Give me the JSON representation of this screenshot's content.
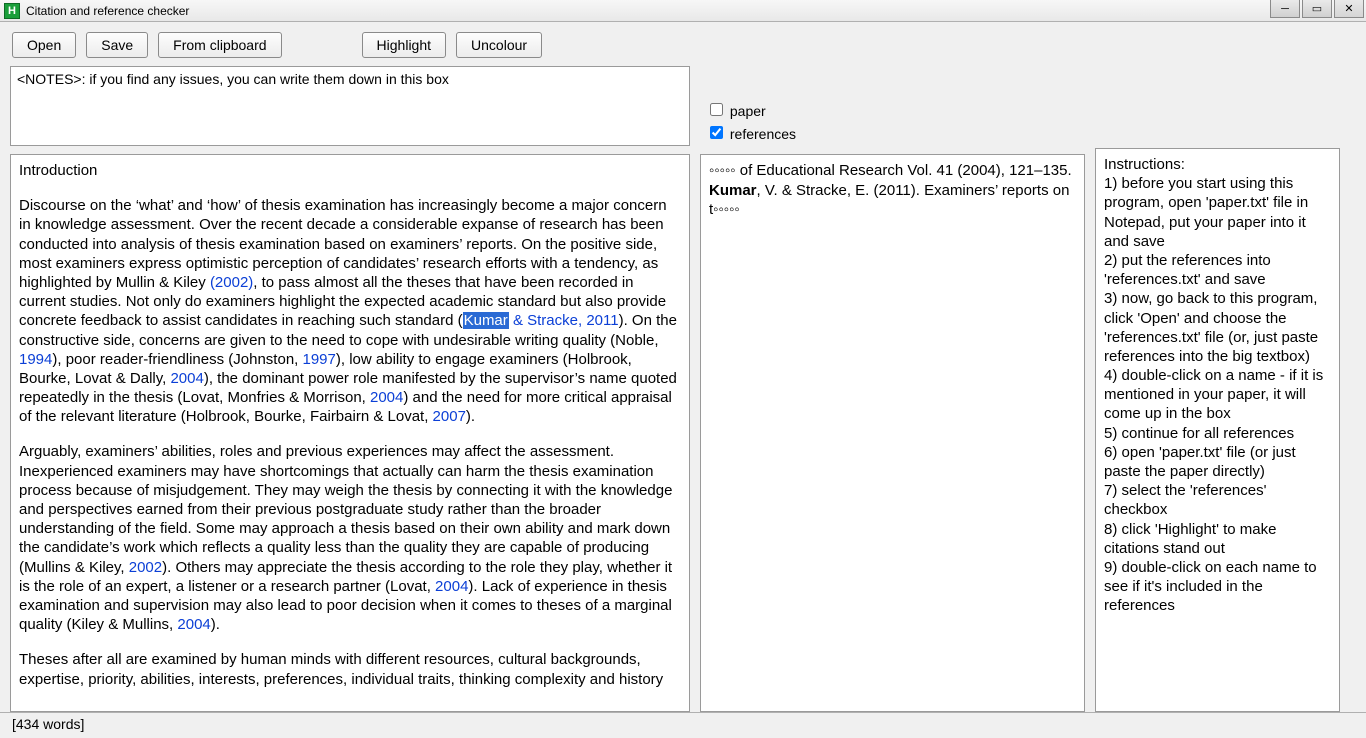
{
  "window": {
    "title": "Citation and reference checker",
    "icon_letter": "H"
  },
  "toolbar": {
    "open": "Open",
    "save": "Save",
    "from_clipboard": "From clipboard",
    "highlight": "Highlight",
    "uncolour": "Uncolour"
  },
  "notes": {
    "value": "<NOTES>: if you find any issues, you can write them down in this box"
  },
  "paper": {
    "heading": "Introduction",
    "para1_a": "Discourse on the ‘what’ and ‘how’ of thesis examination has increasingly become a major concern in knowledge assessment. Over the recent decade a considerable expanse of research has been conducted into analysis of thesis examination based on examiners’ reports. On the positive side, most examiners express optimistic perception of candidates’ research efforts with a tendency, as highlighted by Mullin & Kiley ",
    "cit1": "(2002)",
    "para1_b": ", to pass almost all the theses that have been recorded in current studies. Not only do examiners highlight the expected academic standard but also provide concrete feedback to assist candidates in reaching such standard (",
    "cit2_hl": "Kumar",
    "cit2_rest": " & Stracke, ",
    "cit2_year": "2011",
    "para1_c": "). On the constructive side, concerns are given to the need to cope with undesirable writing quality (Noble, ",
    "cit3": "1994",
    "para1_d": "), poor reader-friendliness (Johnston, ",
    "cit4": "1997",
    "para1_e": "), low ability to engage examiners (Holbrook, Bourke, Lovat & Dally, ",
    "cit5": "2004",
    "para1_f": "), the dominant power role manifested by the supervisor’s name quoted repeatedly in the thesis (Lovat, Monfries & Morrison, ",
    "cit6": "2004",
    "para1_g": ") and the need for more critical appraisal of the relevant literature (Holbrook, Bourke, Fairbairn & Lovat, ",
    "cit7": "2007",
    "para1_h": ").",
    "para2_a": "Arguably, examiners’ abilities, roles and previous experiences may affect the assessment. Inexperienced examiners may have shortcomings that actually can harm the thesis examination process because of misjudgement. They may weigh the thesis by connecting it with the knowledge and perspectives earned from their previous postgraduate study rather than the broader understanding of the field. Some may approach a thesis based on their own ability and mark down the candidate’s work which reflects a quality less than the quality they are capable of producing (Mullins & Kiley, ",
    "cit8": "2002",
    "para2_b": "). Others may appreciate the thesis according to the role they play, whether it is the role of an expert, a listener or a research partner (Lovat, ",
    "cit9": "2004",
    "para2_c": "). Lack of experience in thesis examination and supervision may also lead to poor decision when it comes to theses of a marginal quality (Kiley & Mullins, ",
    "cit10": "2004",
    "para2_d": ").",
    "para3": "Theses after all are examined by human minds with different resources, cultural backgrounds, expertise, priority, abilities, interests, preferences, individual traits, thinking complexity and history"
  },
  "checks": {
    "paper_label": "paper",
    "paper_checked": false,
    "references_label": "references",
    "references_checked": true
  },
  "references": {
    "line1": "◦◦◦◦◦ of Educational Research Vol. 41 (2004), 121–135.",
    "line2_bold": "Kumar",
    "line2_rest": ", V. & Stracke, E. (2011). Examiners’ reports on t◦◦◦◦◦"
  },
  "instructions": {
    "title": "Instructions:",
    "i1": "1) before you start using this program, open 'paper.txt' file in Notepad, put your paper into it and save",
    "i2": "2) put the references into 'references.txt' and save",
    "i3": "3) now, go back to this program, click 'Open' and choose the 'references.txt' file (or, just paste references into the big textbox)",
    "i4": "4) double-click on a name - if it is mentioned in your paper, it will come up in the box",
    "i5": "5) continue for all references",
    "i6": "6) open 'paper.txt' file (or just paste the paper directly)",
    "i7": "7) select the 'references' checkbox",
    "i8": "8) click 'Highlight' to make citations stand out",
    "i9": "9) double-click on each name to see if it's included in the references"
  },
  "status": {
    "wordcount": "[434 words]"
  }
}
